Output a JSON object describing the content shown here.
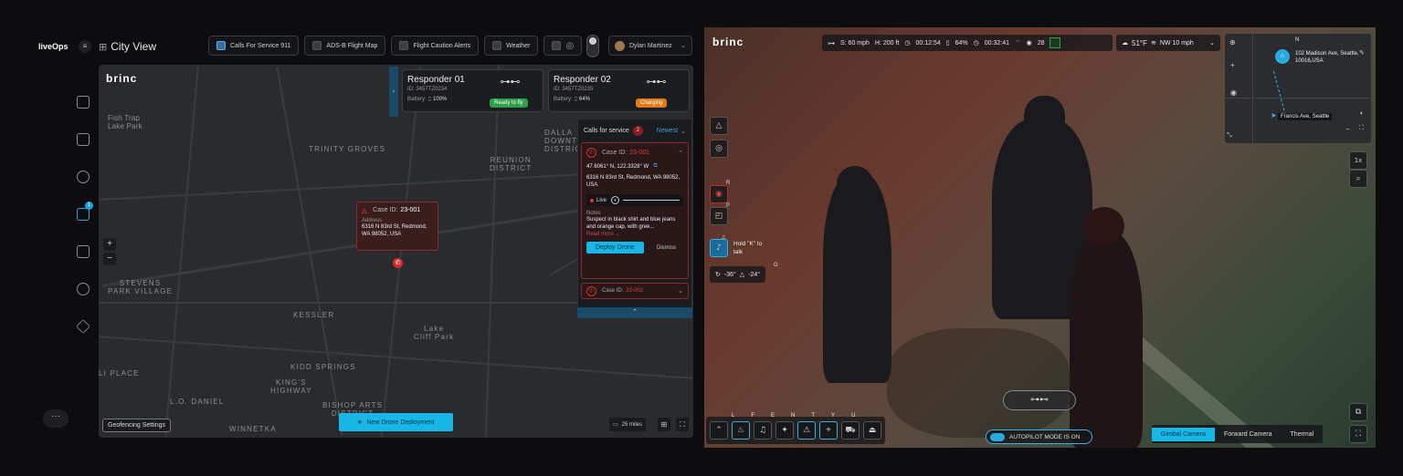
{
  "left": {
    "logo": "liveOps",
    "title": "City View",
    "filters": [
      {
        "label": "Calls For Service 911",
        "checked": true
      },
      {
        "label": "ADS-B Flight Map",
        "checked": false
      },
      {
        "label": "Flight Caution Alerts",
        "checked": false
      },
      {
        "label": "Weather",
        "checked": false
      }
    ],
    "user": "Dylan Martinez",
    "map_brand": "brinc",
    "nav_badge": "1",
    "districts": [
      {
        "text": "TRINITY GROVES"
      },
      {
        "text": "REUNION\nDISTRICT"
      },
      {
        "text": "DALLA\nDOWNTO\nDISTRIC"
      },
      {
        "text": "STEVENS\nPARK VILLAGE"
      },
      {
        "text": "KESSLER"
      },
      {
        "text": "Lake\nCliff Park"
      },
      {
        "text": "KIDD SPRINGS"
      },
      {
        "text": "KING'S\nHIGHWAY"
      },
      {
        "text": "LI PLACE"
      },
      {
        "text": "L.O. DANIEL"
      },
      {
        "text": "BISHOP ARTS\nDISTRICT"
      },
      {
        "text": "WINNETKA"
      },
      {
        "text": "Fish Trap\nLake Park"
      }
    ],
    "popup": {
      "case_label": "Case ID:",
      "case_id": "23-001",
      "addr_label": "Address",
      "address": "6316 N 83rd St, Redmond, WA 98052, USA"
    },
    "responders": [
      {
        "name": "Responder 01",
        "id": "ID: 3457TZ0234",
        "battery_label": "Battery:",
        "battery": "100%",
        "status": "Ready to fly",
        "status_color": "#2fa04a"
      },
      {
        "name": "Responder 02",
        "id": "ID: 3457TZ0235",
        "battery_label": "Battery:",
        "battery": "64%",
        "status": "Charging",
        "status_color": "#e07a1a"
      }
    ],
    "calls": {
      "title": "Calls for service",
      "count": "2",
      "sort": "Newest",
      "case1": {
        "label": "Case ID:",
        "id": "23-001",
        "coords": "47.6061° N, 122.3328° W",
        "address": "6316 N 83rd St, Redmond, WA 98052, USA",
        "live": "Live",
        "notes_label": "Notes",
        "notes": "Suspect in black shirt and blue jeans and orange cap, with gree...",
        "read_more": "Read more",
        "deploy": "Deploy Drone",
        "dismiss": "Dismiss"
      },
      "case2": {
        "label": "Case ID:",
        "id": "23-002"
      }
    },
    "bottom": {
      "geofence": "Geofencing Settings",
      "new_deploy": "New Drone Deployment",
      "scale": "25 miles"
    }
  },
  "right": {
    "brand": "brinc",
    "hud": {
      "speed": "S: 60 mph",
      "height": "H: 200 ft",
      "flight_time": "00:12:54",
      "battery": "64%",
      "remaining": "00:32:41",
      "viewers": "28",
      "temp": "51°F",
      "wind": "NW 10 mph"
    },
    "minimap": {
      "north": "N",
      "address": "102 Madison Ave, Seattle, 10016,USA",
      "street": "Francis Ave, Seattle"
    },
    "side_keys": {
      "r": "R",
      "p": "P",
      "g": "G"
    },
    "talk": "Hold \"K\" to talk",
    "angles": {
      "yaw": "-36°",
      "pitch": "-24°"
    },
    "zoom": "1x",
    "bottom_keys": [
      "L",
      "F",
      "E",
      "N",
      "T",
      "Y",
      "U"
    ],
    "autopilot": "AUTOPILOT MODE IS ON",
    "cameras": [
      {
        "label": "Gimbal Camera",
        "active": true
      },
      {
        "label": "Forward Camera",
        "active": false
      },
      {
        "label": "Thermal",
        "active": false
      }
    ]
  }
}
